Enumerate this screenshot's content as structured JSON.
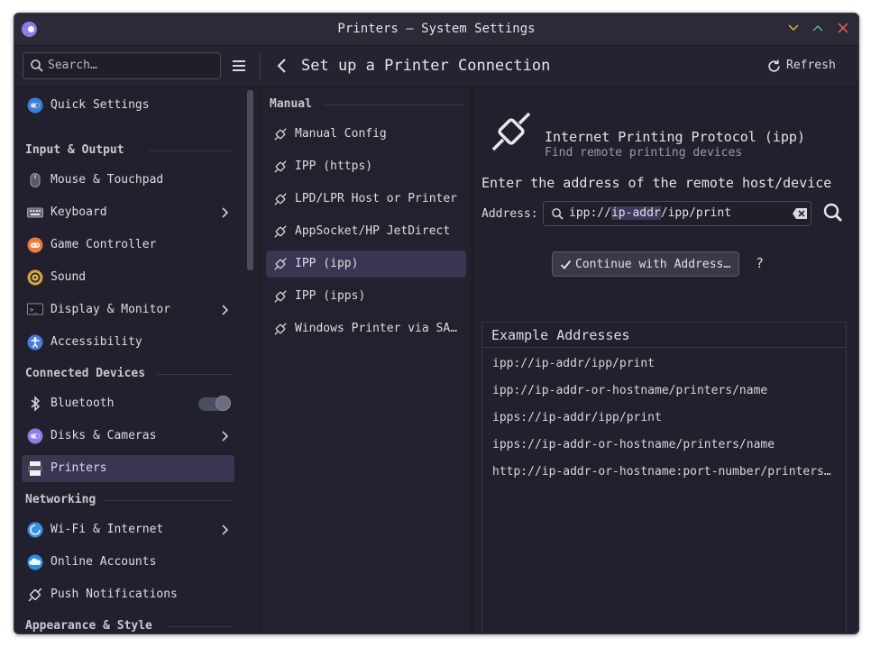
{
  "window": {
    "title": "Printers — System Settings"
  },
  "header": {
    "search_placeholder": "Search…",
    "page_title": "Set up a Printer Connection",
    "refresh_label": "Refresh"
  },
  "sidebar": {
    "quick_settings": "Quick Settings",
    "categories": {
      "input_output": "Input & Output",
      "connected_devices": "Connected Devices",
      "networking": "Networking",
      "appearance": "Appearance & Style"
    },
    "items": {
      "mouse": "Mouse & Touchpad",
      "keyboard": "Keyboard",
      "game_controller": "Game Controller",
      "sound": "Sound",
      "display": "Display & Monitor",
      "accessibility": "Accessibility",
      "bluetooth": "Bluetooth",
      "disks": "Disks & Cameras",
      "printers": "Printers",
      "wifi": "Wi-Fi & Internet",
      "online_accounts": "Online Accounts",
      "push_notifications": "Push Notifications"
    }
  },
  "connections": {
    "category": "Manual",
    "items": [
      "Manual Config",
      "IPP (https)",
      "LPD/LPR Host or Printer",
      "AppSocket/HP JetDirect",
      "IPP (ipp)",
      "IPP (ipps)",
      "Windows Printer via SAMBA"
    ],
    "selected": "IPP (ipp)"
  },
  "detail": {
    "protocol_name": "Internet Printing Protocol (ipp)",
    "protocol_desc": "Find remote printing devices",
    "enter_label": "Enter the address of the remote host/device",
    "address_label": "Address:",
    "address_prefix": "ipp://",
    "address_selected": "ip-addr",
    "address_suffix": "/ipp/print",
    "continue_label": "Continue with Address…",
    "help_label": "?",
    "examples_title": "Example Addresses",
    "examples": [
      "ipp://ip-addr/ipp/print",
      "ipp://ip-addr-or-hostname/printers/name",
      "ipps://ip-addr/ipp/print",
      "ipps://ip-addr-or-hostname/printers/name",
      "http://ip-addr-or-hostname:port-number/printers/name"
    ]
  },
  "colors": {
    "accent": "#8f7ce6",
    "selection": "#3b3553",
    "background": "#21212d"
  }
}
